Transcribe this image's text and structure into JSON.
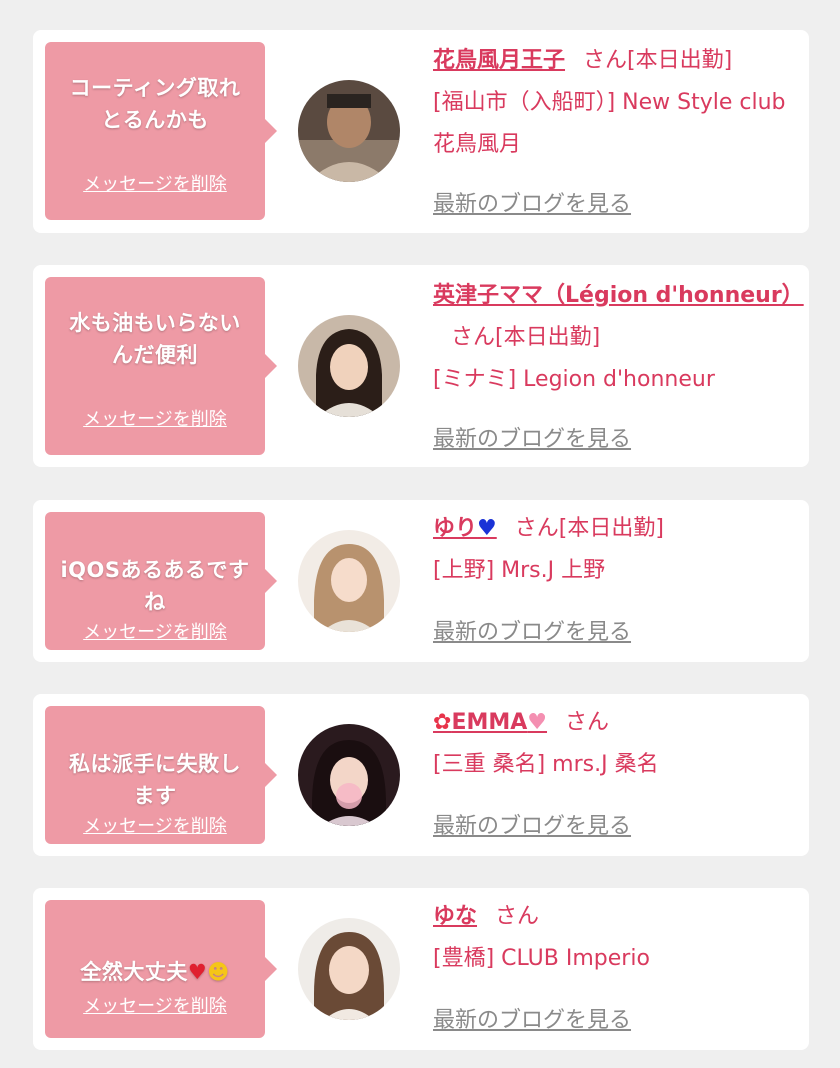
{
  "delete_label": "メッセージを削除",
  "blog_label": "最新のブログを見る",
  "san": "さん",
  "cards": [
    {
      "message": "コーティング取れ\nとるんかも",
      "name": "花鳥風月王子",
      "status": "[本日出勤]",
      "store": "[福山市（入船町）] New Style club花鳥風月"
    },
    {
      "message": "水も油もいらない\nんだ便利",
      "name": "英津子ママ（Légion d'honneur）",
      "status": "[本日出勤]",
      "store": "[ミナミ] Legion d'honneur"
    },
    {
      "message": "iQOSあるあるです\nね",
      "name": "ゆり",
      "name_icon": "blue-heart-icon",
      "status": "[本日出勤]",
      "store": "[上野] Mrs.J 上野"
    },
    {
      "message": "私は派手に失敗し\nます",
      "name": "EMMA",
      "name_icon_pre": "rose-icon",
      "name_icon_post": "pink-heart-icon",
      "status": "",
      "store": "[三重 桑名] mrs.J 桑名"
    },
    {
      "message": "全然大丈夫",
      "name": "ゆな",
      "status": "",
      "store": "[豊橋] CLUB Imperio"
    }
  ],
  "colors": {
    "accent": "#d93a5e",
    "bubble": "#ee9aa5",
    "background": "#efefef",
    "blog_link": "#8a8a8a"
  }
}
